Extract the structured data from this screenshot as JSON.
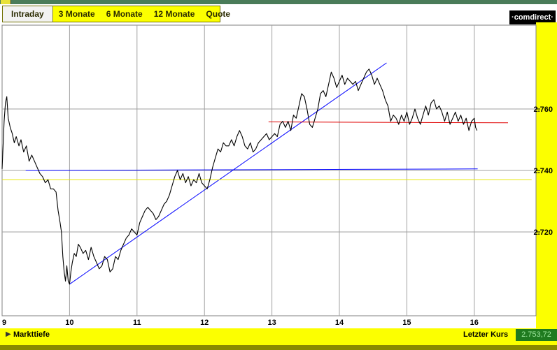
{
  "window": {
    "title": ""
  },
  "tabs": [
    {
      "label": "Intraday",
      "active": true
    },
    {
      "label": "3 Monate",
      "active": false
    },
    {
      "label": "6 Monate",
      "active": false
    },
    {
      "label": "12 Monate",
      "active": false
    },
    {
      "label": "Quote",
      "active": false
    }
  ],
  "brand": {
    "logo_text": "·comdirect·"
  },
  "colors": {
    "tabbar": "#fcff00",
    "y_axis_panel": "#fcff00",
    "price_line": "#000000",
    "trendline": "#0000ff",
    "support_line": "#0000ff",
    "resistance_line": "#e00000",
    "reference_line": "#e8e800",
    "grid": "#a0a0a0",
    "last_price_badge": "#1f7a1f"
  },
  "footer": {
    "depth_label": "Markttiefe",
    "depth_icon": "triangle-right-icon",
    "last_price_label": "Letzter Kurs",
    "last_price_value": "2.753,72"
  },
  "chart_data": {
    "type": "line",
    "xlabel": "",
    "ylabel": "",
    "x_ticks": [
      "9",
      "10",
      "11",
      "12",
      "13",
      "14",
      "15",
      "16"
    ],
    "y_ticks": [
      "2.720",
      "2.740",
      "2.760"
    ],
    "ylim": [
      2701,
      2777
    ],
    "xlim": [
      9.0,
      16.85
    ],
    "grid": true,
    "series": [
      {
        "points": [
          [
            9.0,
            2740.5
          ],
          [
            9.03,
            2756
          ],
          [
            9.05,
            2762
          ],
          [
            9.07,
            2764
          ],
          [
            9.09,
            2757
          ],
          [
            9.12,
            2754
          ],
          [
            9.15,
            2752
          ],
          [
            9.18,
            2749
          ],
          [
            9.21,
            2751
          ],
          [
            9.25,
            2748
          ],
          [
            9.28,
            2750
          ],
          [
            9.32,
            2746
          ],
          [
            9.36,
            2748
          ],
          [
            9.4,
            2743
          ],
          [
            9.44,
            2745
          ],
          [
            9.48,
            2743
          ],
          [
            9.52,
            2741
          ],
          [
            9.56,
            2739
          ],
          [
            9.6,
            2738
          ],
          [
            9.64,
            2736
          ],
          [
            9.68,
            2737
          ],
          [
            9.72,
            2734
          ],
          [
            9.76,
            2734
          ],
          [
            9.8,
            2733
          ],
          [
            9.83,
            2727
          ],
          [
            9.86,
            2723
          ],
          [
            9.88,
            2720
          ],
          [
            9.9,
            2712
          ],
          [
            9.92,
            2707
          ],
          [
            9.94,
            2704
          ],
          [
            9.96,
            2709
          ],
          [
            9.98,
            2704
          ],
          [
            10.0,
            2703
          ],
          [
            10.02,
            2707
          ],
          [
            10.04,
            2710
          ],
          [
            10.07,
            2713
          ],
          [
            10.1,
            2712
          ],
          [
            10.13,
            2716
          ],
          [
            10.16,
            2715
          ],
          [
            10.2,
            2713
          ],
          [
            10.24,
            2714
          ],
          [
            10.28,
            2711
          ],
          [
            10.32,
            2715
          ],
          [
            10.36,
            2712
          ],
          [
            10.4,
            2710
          ],
          [
            10.44,
            2708
          ],
          [
            10.48,
            2709
          ],
          [
            10.52,
            2712
          ],
          [
            10.56,
            2711
          ],
          [
            10.6,
            2707
          ],
          [
            10.64,
            2708
          ],
          [
            10.68,
            2712
          ],
          [
            10.72,
            2711
          ],
          [
            10.76,
            2714
          ],
          [
            10.8,
            2716
          ],
          [
            10.84,
            2718
          ],
          [
            10.88,
            2719
          ],
          [
            10.92,
            2721
          ],
          [
            10.96,
            2720
          ],
          [
            11.0,
            2719
          ],
          [
            11.04,
            2723
          ],
          [
            11.08,
            2725
          ],
          [
            11.12,
            2727
          ],
          [
            11.16,
            2728
          ],
          [
            11.2,
            2727
          ],
          [
            11.24,
            2726
          ],
          [
            11.28,
            2724
          ],
          [
            11.32,
            2725
          ],
          [
            11.36,
            2727
          ],
          [
            11.4,
            2729
          ],
          [
            11.44,
            2730
          ],
          [
            11.48,
            2732
          ],
          [
            11.52,
            2735
          ],
          [
            11.56,
            2738
          ],
          [
            11.6,
            2740
          ],
          [
            11.64,
            2737
          ],
          [
            11.68,
            2739
          ],
          [
            11.72,
            2736
          ],
          [
            11.76,
            2738
          ],
          [
            11.8,
            2735
          ],
          [
            11.84,
            2737
          ],
          [
            11.88,
            2736
          ],
          [
            11.92,
            2739
          ],
          [
            11.96,
            2736
          ],
          [
            12.0,
            2735
          ],
          [
            12.04,
            2734
          ],
          [
            12.08,
            2737
          ],
          [
            12.12,
            2741
          ],
          [
            12.16,
            2744
          ],
          [
            12.2,
            2747
          ],
          [
            12.24,
            2746
          ],
          [
            12.28,
            2749
          ],
          [
            12.32,
            2748
          ],
          [
            12.36,
            2748
          ],
          [
            12.4,
            2750
          ],
          [
            12.44,
            2748
          ],
          [
            12.48,
            2751
          ],
          [
            12.52,
            2753
          ],
          [
            12.56,
            2751
          ],
          [
            12.6,
            2748
          ],
          [
            12.64,
            2747
          ],
          [
            12.68,
            2749
          ],
          [
            12.72,
            2746
          ],
          [
            12.76,
            2747
          ],
          [
            12.8,
            2749
          ],
          [
            12.84,
            2750
          ],
          [
            12.88,
            2751
          ],
          [
            12.92,
            2752
          ],
          [
            12.96,
            2750
          ],
          [
            13.0,
            2751
          ],
          [
            13.04,
            2752
          ],
          [
            13.08,
            2751
          ],
          [
            13.12,
            2755
          ],
          [
            13.16,
            2756
          ],
          [
            13.2,
            2754
          ],
          [
            13.24,
            2756
          ],
          [
            13.28,
            2753
          ],
          [
            13.32,
            2758
          ],
          [
            13.36,
            2757
          ],
          [
            13.4,
            2761
          ],
          [
            13.44,
            2765
          ],
          [
            13.48,
            2764
          ],
          [
            13.52,
            2760
          ],
          [
            13.56,
            2755
          ],
          [
            13.6,
            2754
          ],
          [
            13.64,
            2757
          ],
          [
            13.68,
            2760
          ],
          [
            13.72,
            2765
          ],
          [
            13.76,
            2766
          ],
          [
            13.8,
            2764
          ],
          [
            13.84,
            2768
          ],
          [
            13.88,
            2772
          ],
          [
            13.92,
            2770
          ],
          [
            13.96,
            2767
          ],
          [
            14.0,
            2769
          ],
          [
            14.04,
            2771
          ],
          [
            14.08,
            2768
          ],
          [
            14.12,
            2770
          ],
          [
            14.16,
            2769
          ],
          [
            14.2,
            2768
          ],
          [
            14.24,
            2769
          ],
          [
            14.28,
            2766
          ],
          [
            14.32,
            2768
          ],
          [
            14.36,
            2770
          ],
          [
            14.4,
            2772
          ],
          [
            14.44,
            2773
          ],
          [
            14.48,
            2771
          ],
          [
            14.52,
            2768
          ],
          [
            14.56,
            2770
          ],
          [
            14.6,
            2768
          ],
          [
            14.64,
            2766
          ],
          [
            14.68,
            2763
          ],
          [
            14.72,
            2761
          ],
          [
            14.76,
            2756
          ],
          [
            14.8,
            2758
          ],
          [
            14.84,
            2757
          ],
          [
            14.88,
            2755
          ],
          [
            14.92,
            2758
          ],
          [
            14.96,
            2756
          ],
          [
            15.0,
            2759
          ],
          [
            15.04,
            2755
          ],
          [
            15.08,
            2757
          ],
          [
            15.12,
            2760
          ],
          [
            15.16,
            2757
          ],
          [
            15.2,
            2755
          ],
          [
            15.24,
            2758
          ],
          [
            15.28,
            2761
          ],
          [
            15.32,
            2758
          ],
          [
            15.36,
            2762
          ],
          [
            15.4,
            2763
          ],
          [
            15.44,
            2760
          ],
          [
            15.48,
            2761
          ],
          [
            15.52,
            2759
          ],
          [
            15.56,
            2756
          ],
          [
            15.6,
            2759
          ],
          [
            15.64,
            2755
          ],
          [
            15.68,
            2757
          ],
          [
            15.72,
            2759
          ],
          [
            15.76,
            2756
          ],
          [
            15.8,
            2758
          ],
          [
            15.84,
            2755
          ],
          [
            15.88,
            2757
          ],
          [
            15.92,
            2753
          ],
          [
            15.96,
            2756
          ],
          [
            16.0,
            2757
          ],
          [
            16.02,
            2754
          ],
          [
            16.04,
            2753
          ]
        ]
      }
    ],
    "trendlines": [
      {
        "from": [
          10.0,
          2703.0
        ],
        "to": [
          14.7,
          2775.0
        ],
        "style": "blue"
      },
      {
        "from": [
          9.35,
          2740.0
        ],
        "to": [
          16.05,
          2740.5
        ],
        "style": "blue"
      },
      {
        "from": [
          12.95,
          2755.8
        ],
        "to": [
          16.5,
          2755.5
        ],
        "style": "red"
      },
      {
        "from": [
          9.0,
          2737.0
        ],
        "to": [
          16.85,
          2737.0
        ],
        "style": "yellow"
      }
    ]
  }
}
